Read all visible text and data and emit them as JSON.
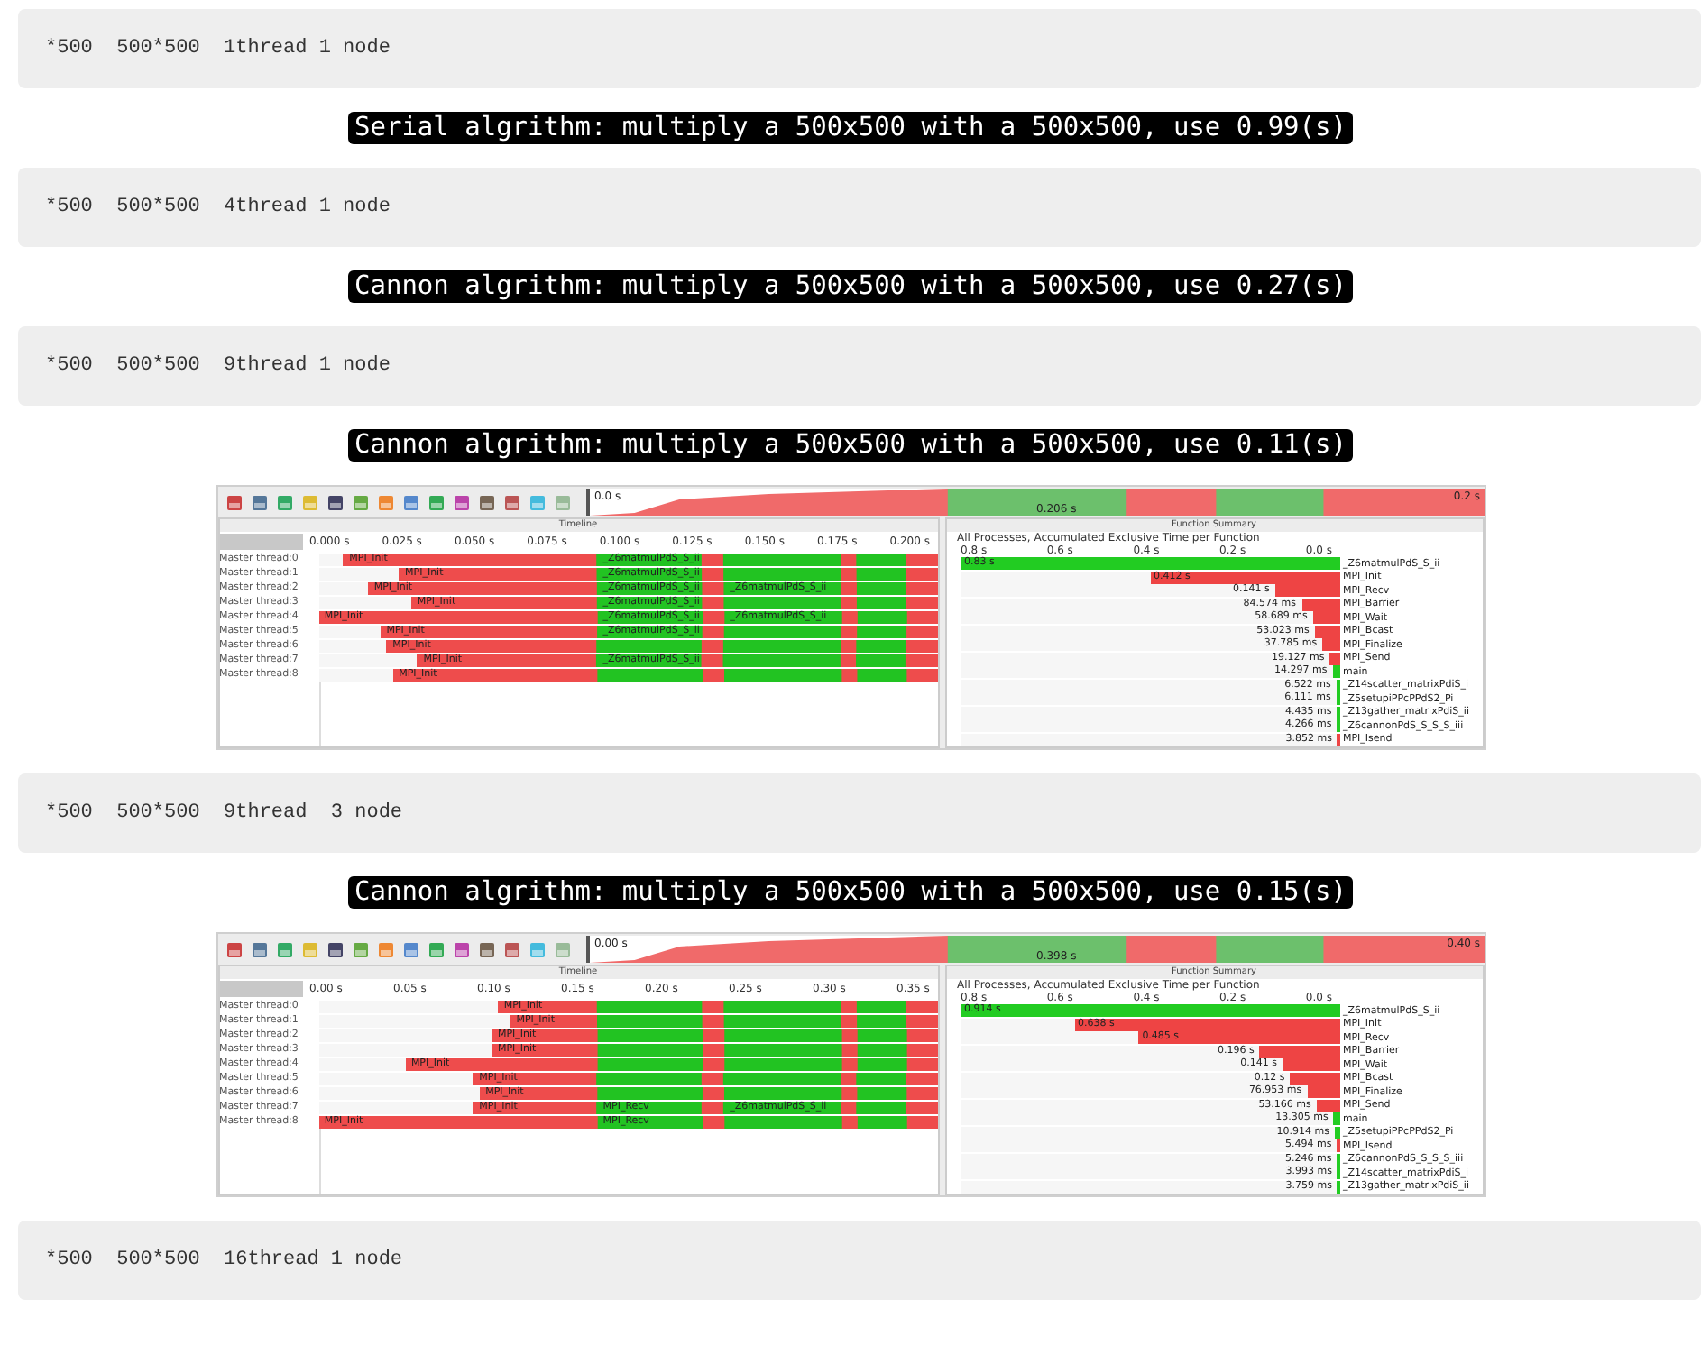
{
  "sections": [
    {
      "kind": "code",
      "text": "*500  500*500  1thread 1 node"
    },
    {
      "kind": "terminal",
      "text": "Serial algrithm: multiply a 500x500 with a 500x500, use 0.99(s)"
    },
    {
      "kind": "code",
      "text": "*500  500*500  4thread 1 node"
    },
    {
      "kind": "terminal",
      "text": "Cannon algrithm: multiply a 500x500 with a 500x500, use 0.27(s)"
    },
    {
      "kind": "code",
      "text": "*500  500*500  9thread 1 node"
    },
    {
      "kind": "terminal",
      "text": "Cannon algrithm: multiply a 500x500 with a 500x500, use 0.11(s)"
    },
    {
      "kind": "profiler",
      "overview": {
        "start": "0.0 s",
        "middle": "0.206 s",
        "end": "0.2 s"
      },
      "timeline": {
        "title": "Timeline",
        "ticks": [
          "0.000 s",
          "0.025 s",
          "0.050 s",
          "0.075 s",
          "0.100 s",
          "0.125 s",
          "0.150 s",
          "0.175 s",
          "0.200 s"
        ],
        "threads": [
          {
            "name": "Master thread:0",
            "level": 0.96,
            "labels": [
              "MPI_Init",
              "_Z6matmulPdS_S_ii"
            ]
          },
          {
            "name": "Master thread:1",
            "level": 0.87,
            "labels": [
              "MPI_Init",
              "_Z6matmulPdS_S_ii"
            ]
          },
          {
            "name": "Master thread:2",
            "level": 0.92,
            "labels": [
              "MPI_Init",
              "_Z6matmulPdS_S_ii",
              "_Z6matmulPdS_S_ii"
            ]
          },
          {
            "name": "Master thread:3",
            "level": 0.85,
            "labels": [
              "MPI_Init",
              "_Z6matmulPdS_S_ii"
            ]
          },
          {
            "name": "Master thread:4",
            "level": 1.0,
            "labels": [
              "MPI_Init",
              "_Z6matmulPdS_S_ii",
              "_Z6matmulPdS_S_ii"
            ]
          },
          {
            "name": "Master thread:5",
            "level": 0.9,
            "labels": [
              "MPI_Init",
              "_Z6matmulPdS_S_ii"
            ]
          },
          {
            "name": "Master thread:6",
            "level": 0.89,
            "labels": [
              "MPI_Init"
            ]
          },
          {
            "name": "Master thread:7",
            "level": 0.84,
            "labels": [
              "MPI_Init",
              "_Z6matmulPdS_S_ii"
            ]
          },
          {
            "name": "Master thread:8",
            "level": 0.88,
            "labels": [
              "MPI_Init"
            ]
          }
        ]
      },
      "summary": {
        "title": "Function Summary",
        "subtitle": "All Processes, Accumulated Exclusive Time per Function",
        "ticks": [
          "0.8 s",
          "0.6 s",
          "0.4 s",
          "0.2 s",
          "0.0 s"
        ],
        "rows": [
          {
            "value": "0.83 s",
            "name": "_Z6matmulPdS_S_ii",
            "level": 1.0,
            "color": "#22cc22"
          },
          {
            "value": "0.412 s",
            "name": "MPI_Init",
            "level": 0.5,
            "color": "#ee4444"
          },
          {
            "value": "0.141 s",
            "name": "MPI_Recv",
            "level": 0.17,
            "color": "#ee4444"
          },
          {
            "value": "84.574 ms",
            "name": "MPI_Barrier",
            "level": 0.1,
            "color": "#ee4444"
          },
          {
            "value": "58.689 ms",
            "name": "MPI_Wait",
            "level": 0.07,
            "color": "#ee4444"
          },
          {
            "value": "53.023 ms",
            "name": "MPI_Bcast",
            "level": 0.065,
            "color": "#ee4444"
          },
          {
            "value": "37.785 ms",
            "name": "MPI_Finalize",
            "level": 0.045,
            "color": "#ee4444"
          },
          {
            "value": "19.127 ms",
            "name": "MPI_Send",
            "level": 0.025,
            "color": "#ee4444"
          },
          {
            "value": "14.297 ms",
            "name": "main",
            "level": 0.018,
            "color": "#22cc22"
          },
          {
            "value": "6.522 ms",
            "name": "_Z14scatter_matrixPdiS_i",
            "level": 0.008,
            "color": "#22cc22"
          },
          {
            "value": "6.111 ms",
            "name": "_Z5setupiPPcPPdS2_Pi",
            "level": 0.008,
            "color": "#22cc22"
          },
          {
            "value": "4.435 ms",
            "name": "_Z13gather_matrixPdiS_ii",
            "level": 0.006,
            "color": "#22cc22"
          },
          {
            "value": "4.266 ms",
            "name": "_Z6cannonPdS_S_S_S_iii",
            "level": 0.006,
            "color": "#22cc22"
          },
          {
            "value": "3.852 ms",
            "name": "MPI_Isend",
            "level": 0.005,
            "color": "#ee4444"
          }
        ]
      }
    },
    {
      "kind": "code",
      "text": "*500  500*500  9thread  3 node"
    },
    {
      "kind": "terminal",
      "text": "Cannon algrithm: multiply a 500x500 with a 500x500, use 0.15(s)"
    },
    {
      "kind": "profiler",
      "overview": {
        "start": "0.00 s",
        "middle": "0.398 s",
        "end": "0.40 s"
      },
      "timeline": {
        "title": "Timeline",
        "ticks": [
          "0.00 s",
          "0.05 s",
          "0.10 s",
          "0.15 s",
          "0.20 s",
          "0.25 s",
          "0.30 s",
          "0.35 s"
        ],
        "threads": [
          {
            "name": "Master thread:0",
            "level": 0.71,
            "labels": [
              "MPI_Init"
            ]
          },
          {
            "name": "Master thread:1",
            "level": 0.69,
            "labels": [
              "MPI_Init"
            ]
          },
          {
            "name": "Master thread:2",
            "level": 0.72,
            "labels": [
              "MPI_Init"
            ]
          },
          {
            "name": "Master thread:3",
            "level": 0.72,
            "labels": [
              "MPI_Init"
            ]
          },
          {
            "name": "Master thread:4",
            "level": 0.86,
            "labels": [
              "MPI_Init"
            ]
          },
          {
            "name": "Master thread:5",
            "level": 0.75,
            "labels": [
              "MPI_Init"
            ]
          },
          {
            "name": "Master thread:6",
            "level": 0.74,
            "labels": [
              "MPI_Init"
            ]
          },
          {
            "name": "Master thread:7",
            "level": 0.75,
            "labels": [
              "MPI_Init",
              "MPI_Recv",
              "_Z6matmulPdS_S_ii"
            ]
          },
          {
            "name": "Master thread:8",
            "level": 1.0,
            "labels": [
              "MPI_Init",
              "MPI_Recv"
            ]
          }
        ]
      },
      "summary": {
        "title": "Function Summary",
        "subtitle": "All Processes, Accumulated Exclusive Time per Function",
        "ticks": [
          "0.8 s",
          "0.6 s",
          "0.4 s",
          "0.2 s",
          "0.0 s"
        ],
        "rows": [
          {
            "value": "0.914 s",
            "name": "_Z6matmulPdS_S_ii",
            "level": 1.0,
            "color": "#22cc22"
          },
          {
            "value": "0.638 s",
            "name": "MPI_Init",
            "level": 0.7,
            "color": "#ee4444"
          },
          {
            "value": "0.485 s",
            "name": "MPI_Recv",
            "level": 0.53,
            "color": "#ee4444"
          },
          {
            "value": "0.196 s",
            "name": "MPI_Barrier",
            "level": 0.21,
            "color": "#ee4444"
          },
          {
            "value": "0.141 s",
            "name": "MPI_Wait",
            "level": 0.15,
            "color": "#ee4444"
          },
          {
            "value": "0.12 s",
            "name": "MPI_Bcast",
            "level": 0.13,
            "color": "#ee4444"
          },
          {
            "value": "76.953 ms",
            "name": "MPI_Finalize",
            "level": 0.085,
            "color": "#ee4444"
          },
          {
            "value": "53.166 ms",
            "name": "MPI_Send",
            "level": 0.06,
            "color": "#ee4444"
          },
          {
            "value": "13.305 ms",
            "name": "main",
            "level": 0.015,
            "color": "#22cc22"
          },
          {
            "value": "10.914 ms",
            "name": "_Z5setupiPPcPPdS2_Pi",
            "level": 0.012,
            "color": "#22cc22"
          },
          {
            "value": "5.494 ms",
            "name": "MPI_Isend",
            "level": 0.006,
            "color": "#ee4444"
          },
          {
            "value": "5.246 ms",
            "name": "_Z6cannonPdS_S_S_S_iii",
            "level": 0.006,
            "color": "#22cc22"
          },
          {
            "value": "3.993 ms",
            "name": "_Z14scatter_matrixPdiS_i",
            "level": 0.005,
            "color": "#22cc22"
          },
          {
            "value": "3.759 ms",
            "name": "_Z13gather_matrixPdiS_ii",
            "level": 0.005,
            "color": "#22cc22"
          }
        ]
      }
    },
    {
      "kind": "code",
      "text": "*500  500*500  16thread 1 node"
    }
  ]
}
